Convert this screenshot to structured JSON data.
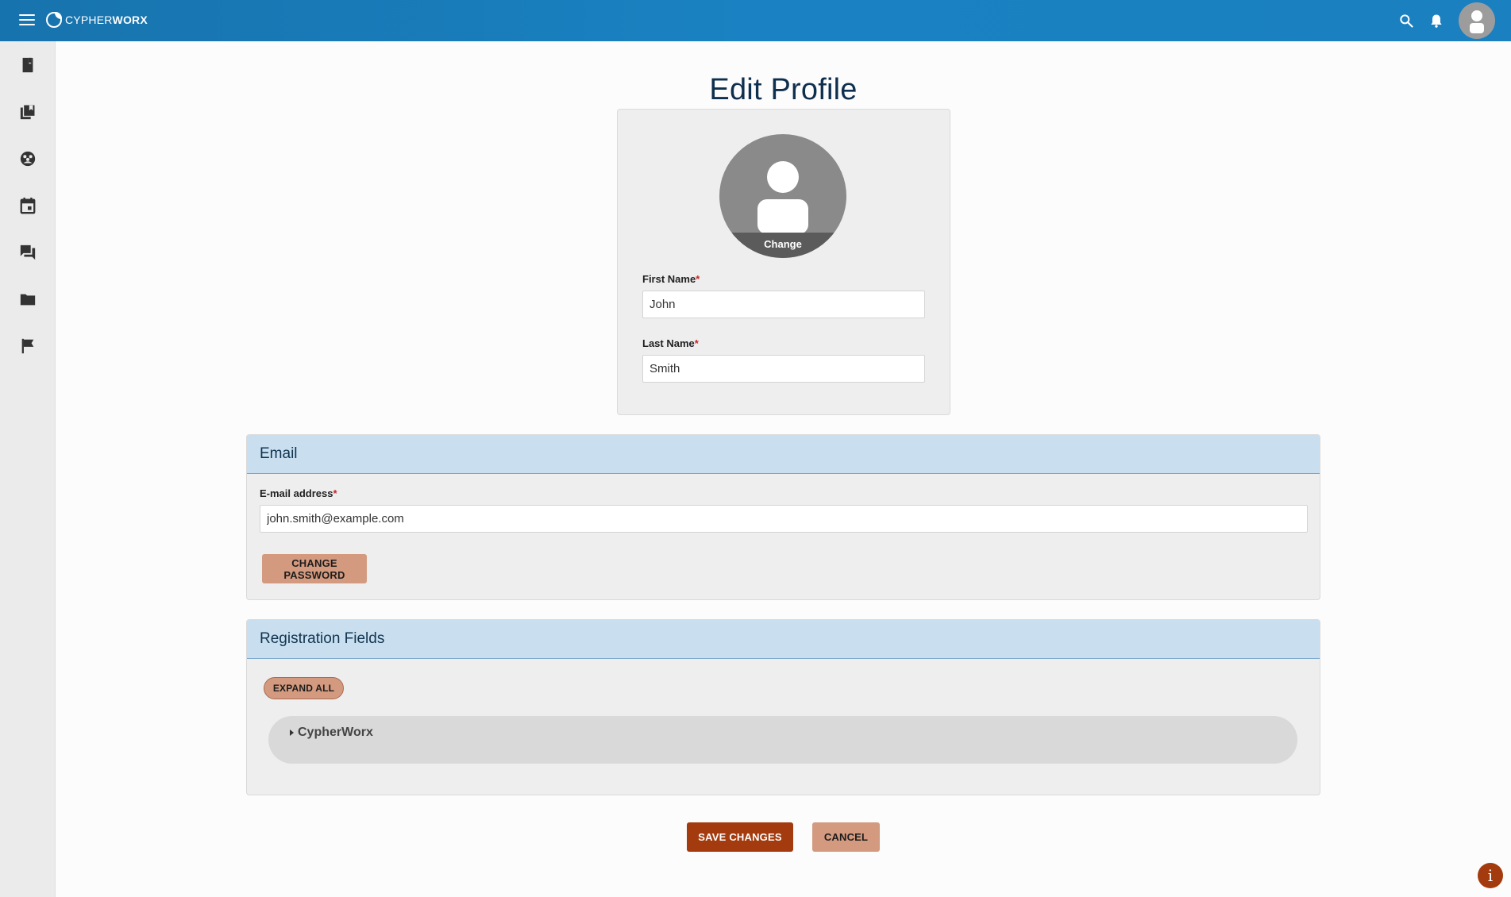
{
  "app": {
    "brand_light": "CYPHER",
    "brand_bold": "WORX"
  },
  "topbar": {
    "icons": [
      "menu-icon",
      "search-icon",
      "bell-icon",
      "avatar-icon"
    ]
  },
  "sidebar": {
    "items": [
      "book-icon",
      "library-icon",
      "community-icon",
      "calendar-icon",
      "chat-icon",
      "folder-icon",
      "flag-icon"
    ]
  },
  "page": {
    "title": "Edit Profile"
  },
  "profile": {
    "avatar_change": "Change",
    "first_name_label": "First Name",
    "first_name_value": "John",
    "last_name_label": "Last Name",
    "last_name_value": "Smith",
    "required_mark": "*"
  },
  "email_section": {
    "title": "Email",
    "email_label": "E-mail address",
    "email_value": "john.smith@example.com",
    "change_password": "CHANGE PASSWORD"
  },
  "registration": {
    "title": "Registration Fields",
    "expand_all": "EXPAND ALL",
    "group_label": "CypherWorx"
  },
  "actions": {
    "save": "SAVE CHANGES",
    "cancel": "CANCEL"
  },
  "info": {
    "label": "i"
  },
  "colors": {
    "topbar": "#1a80c0",
    "accent_dark": "#a33b0e",
    "accent_light": "#d39a7f",
    "section_header": "#c9dff0",
    "title": "#0f2f4e"
  }
}
